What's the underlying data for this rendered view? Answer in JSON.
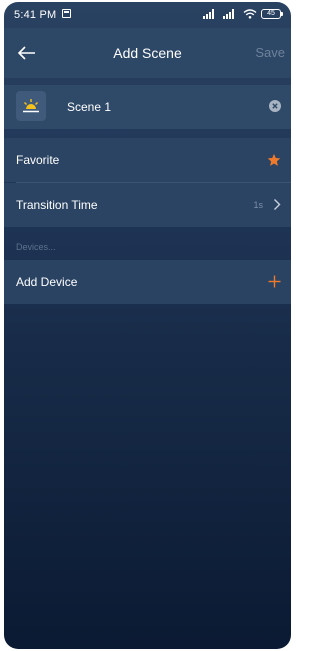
{
  "status_bar": {
    "time": "5:41 PM",
    "battery": "45"
  },
  "nav": {
    "title": "Add Scene",
    "save_label": "Save"
  },
  "scene": {
    "name_value": "Scene 1",
    "icon": "sunrise-icon"
  },
  "settings": {
    "favorite_label": "Favorite",
    "favorite_icon": "star-icon",
    "transition_label": "Transition Time",
    "transition_value": "1s"
  },
  "devices": {
    "section_label": "Devices...",
    "add_device_label": "Add Device"
  },
  "colors": {
    "accent": "#f07a2a",
    "sun": "#f5c21b",
    "nav_background": "#2d4766",
    "row_background": "#2b4464"
  }
}
